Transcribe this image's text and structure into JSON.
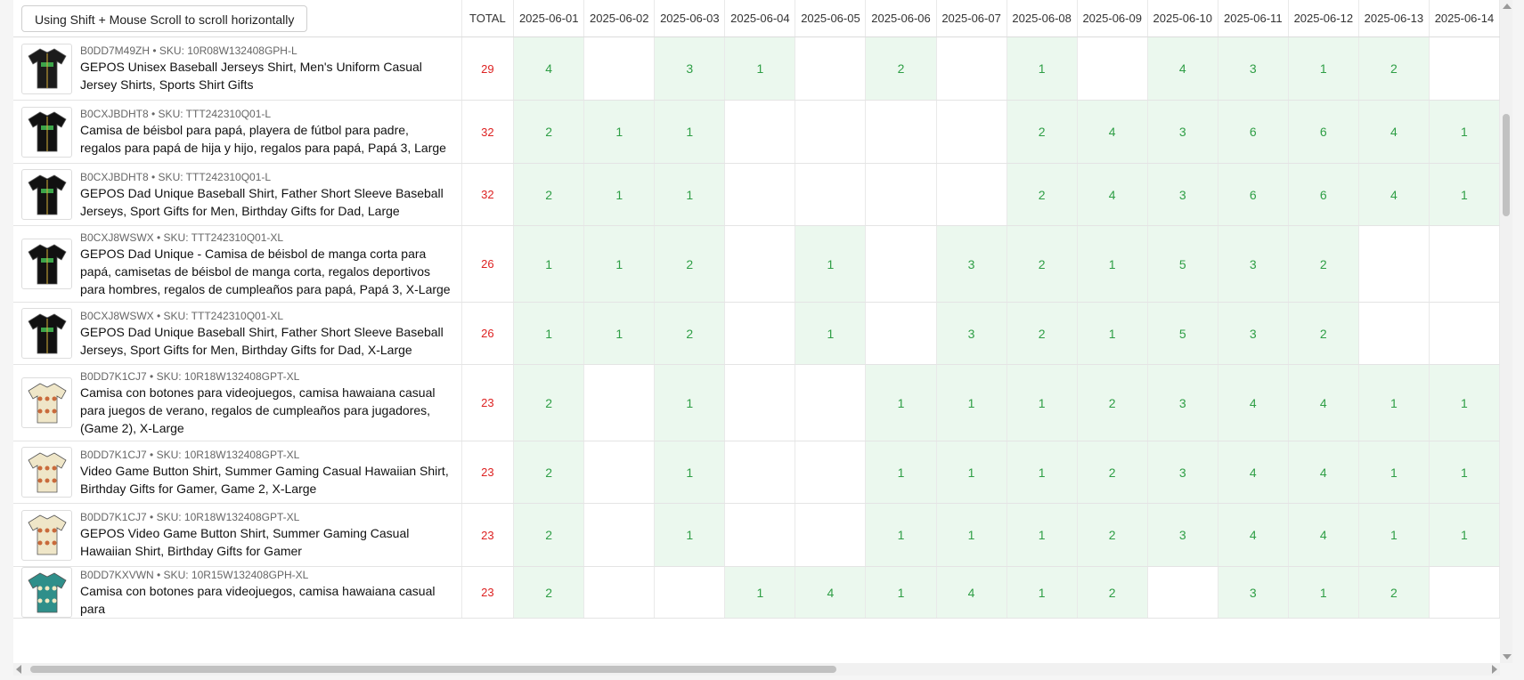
{
  "header": {
    "scroll_hint": "Using Shift + Mouse Scroll to scroll horizontally",
    "total_label": "TOTAL",
    "dates": [
      "2025-06-01",
      "2025-06-02",
      "2025-06-03",
      "2025-06-04",
      "2025-06-05",
      "2025-06-06",
      "2025-06-07",
      "2025-06-08",
      "2025-06-09",
      "2025-06-10",
      "2025-06-11",
      "2025-06-12",
      "2025-06-13",
      "2025-06-14"
    ]
  },
  "rows": [
    {
      "meta": "B0DD7M49ZH • SKU: 10R08W132408GPH-L",
      "name": "GEPOS Unisex Baseball Jerseys Shirt, Men's Uniform Casual Jersey Shirts, Sports Shirt Gifts",
      "total": "29",
      "image": "black-baseball-jersey-icon",
      "shirt_color": "#1b1b1b",
      "values": [
        "4",
        "",
        "3",
        "1",
        "",
        "2",
        "",
        "1",
        "",
        "4",
        "3",
        "1",
        "2",
        ""
      ]
    },
    {
      "meta": "B0CXJBDHT8 • SKU: TTT242310Q01-L",
      "name": "Camisa de béisbol para papá, playera de fútbol para padre, regalos para papá de hija y hijo, regalos para papá, Papá 3, Large",
      "total": "32",
      "image": "black-baseball-jersey-icon",
      "shirt_color": "#111111",
      "values": [
        "2",
        "1",
        "1",
        "",
        "",
        "",
        "",
        "2",
        "4",
        "3",
        "6",
        "6",
        "4",
        "1"
      ]
    },
    {
      "meta": "B0CXJBDHT8 • SKU: TTT242310Q01-L",
      "name": "GEPOS Dad Unique Baseball Shirt, Father Short Sleeve Baseball Jerseys, Sport Gifts for Men, Birthday Gifts for Dad, Large",
      "total": "32",
      "image": "black-baseball-jersey-icon",
      "shirt_color": "#111111",
      "values": [
        "2",
        "1",
        "1",
        "",
        "",
        "",
        "",
        "2",
        "4",
        "3",
        "6",
        "6",
        "4",
        "1"
      ]
    },
    {
      "meta": "B0CXJ8WSWX • SKU: TTT242310Q01-XL",
      "name": "GEPOS Dad Unique - Camisa de béisbol de manga corta para papá, camisetas de béisbol de manga corta, regalos deportivos para hombres, regalos de cumpleaños para papá, Papá 3, X-Large",
      "total": "26",
      "image": "black-baseball-jersey-icon",
      "shirt_color": "#111111",
      "values": [
        "1",
        "1",
        "2",
        "",
        "1",
        "",
        "3",
        "2",
        "1",
        "5",
        "3",
        "2",
        "",
        ""
      ]
    },
    {
      "meta": "B0CXJ8WSWX • SKU: TTT242310Q01-XL",
      "name": "GEPOS Dad Unique Baseball Shirt, Father Short Sleeve Baseball Jerseys, Sport Gifts for Men, Birthday Gifts for Dad, X-Large",
      "total": "26",
      "image": "black-baseball-jersey-icon",
      "shirt_color": "#111111",
      "values": [
        "1",
        "1",
        "2",
        "",
        "1",
        "",
        "3",
        "2",
        "1",
        "5",
        "3",
        "2",
        "",
        ""
      ]
    },
    {
      "meta": "B0DD7K1CJ7 • SKU: 10R18W132408GPT-XL",
      "name": "Camisa con botones para videojuegos, camisa hawaiana casual para juegos de verano, regalos de cumpleaños para jugadores, (Game 2), X-Large",
      "total": "23",
      "image": "hawaiian-shirt-icon",
      "shirt_color": "#efe6c8",
      "values": [
        "2",
        "",
        "1",
        "",
        "",
        "1",
        "1",
        "1",
        "2",
        "3",
        "4",
        "4",
        "1",
        "1"
      ]
    },
    {
      "meta": "B0DD7K1CJ7 • SKU: 10R18W132408GPT-XL",
      "name": "Video Game Button Shirt, Summer Gaming Casual Hawaiian Shirt, Birthday Gifts for Gamer, Game 2, X-Large",
      "total": "23",
      "image": "hawaiian-shirt-icon",
      "shirt_color": "#efe6c8",
      "values": [
        "2",
        "",
        "1",
        "",
        "",
        "1",
        "1",
        "1",
        "2",
        "3",
        "4",
        "4",
        "1",
        "1"
      ]
    },
    {
      "meta": "B0DD7K1CJ7 • SKU: 10R18W132408GPT-XL",
      "name": "GEPOS Video Game Button Shirt, Summer Gaming Casual Hawaiian Shirt, Birthday Gifts for Gamer",
      "total": "23",
      "image": "hawaiian-shirt-icon",
      "shirt_color": "#efe6c8",
      "values": [
        "2",
        "",
        "1",
        "",
        "",
        "1",
        "1",
        "1",
        "2",
        "3",
        "4",
        "4",
        "1",
        "1"
      ]
    },
    {
      "meta": "B0DD7KXVWN • SKU: 10R15W132408GPH-XL",
      "name": "Camisa con botones para videojuegos, camisa hawaiana casual para",
      "total": "23",
      "image": "teal-hawaiian-shirt-icon",
      "shirt_color": "#2f8f8a",
      "values": [
        "2",
        "",
        "",
        "1",
        "4",
        "1",
        "4",
        "1",
        "2",
        "",
        "3",
        "1",
        "2",
        ""
      ]
    }
  ]
}
